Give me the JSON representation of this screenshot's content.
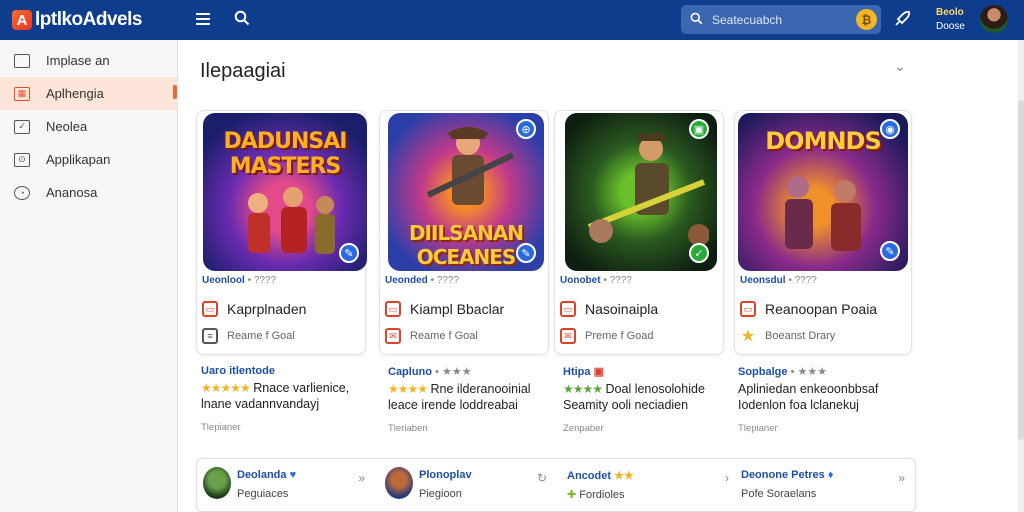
{
  "header": {
    "logo_text": "lptlkoAdvels",
    "search_placeholder": "Seatecuabch",
    "user_name": "Beolo",
    "user_sub": "Doose"
  },
  "sidebar": {
    "items": [
      {
        "label": "Implase an"
      },
      {
        "label": "Aplhengia"
      },
      {
        "label": "Neolea"
      },
      {
        "label": "Applikapan"
      },
      {
        "label": "Ananosa"
      }
    ]
  },
  "main": {
    "title": "Ilepaagiai",
    "cards": [
      {
        "art_title": "DADUNSAI MASTERS",
        "meta": "Ueonlool",
        "meta_dots": "• ????",
        "row1": "Kaprplnaden",
        "row2": "Reame f Goal"
      },
      {
        "art_title": "DIILSANAN OCEANES",
        "meta": "Ueonded",
        "meta_dots": "• ????",
        "row1": "Kiampl Bbaclar",
        "row2": "Reame f Goal"
      },
      {
        "art_title": "",
        "meta": "Uonobet",
        "meta_dots": "• ????",
        "row1": "Nasoinaipla",
        "row2": "Preme f Goad"
      },
      {
        "art_title": "DOMNDS",
        "meta": "Ueonsdul",
        "meta_dots": "• ????",
        "row1": "Reanoopan Poaia",
        "row2": "Boeanst Drary"
      }
    ],
    "infos": [
      {
        "head": "Uaro itlentode",
        "line1": "Rnace varlienice,",
        "line2": "lnane vadannvandayj",
        "foot": "Tlepianer",
        "stars": "★★★★★"
      },
      {
        "head": "Capluno",
        "head_extra": "• ★★★",
        "line1": "Rne ilderanooinial",
        "line2": "leace irende loddreabai",
        "foot": "Tleriaben",
        "stars": "★★★★"
      },
      {
        "head": "Htipa",
        "head_extra": "▣",
        "line1": "Doal lenosolohide",
        "line2": "Seamity ooli neciadien",
        "foot": "Zenpaber",
        "stars": "★★★★"
      },
      {
        "head": "Sopbalge",
        "head_extra": "• ★★★",
        "line1": "Apliniedan enkeoonbbsaf",
        "line2": "Iodenlon foa lclanekuj",
        "foot": "Tlepianer"
      }
    ],
    "bottom": [
      {
        "title": "Deolanda",
        "sub": "Peguiaces"
      },
      {
        "title": "Plonoplav",
        "sub": "Piegioon"
      },
      {
        "title": "Ancodet",
        "title_extra": "★★",
        "sub": "Fordioles"
      },
      {
        "title": "Deonone Petres",
        "sub": "Pofe Soraelans"
      }
    ]
  }
}
